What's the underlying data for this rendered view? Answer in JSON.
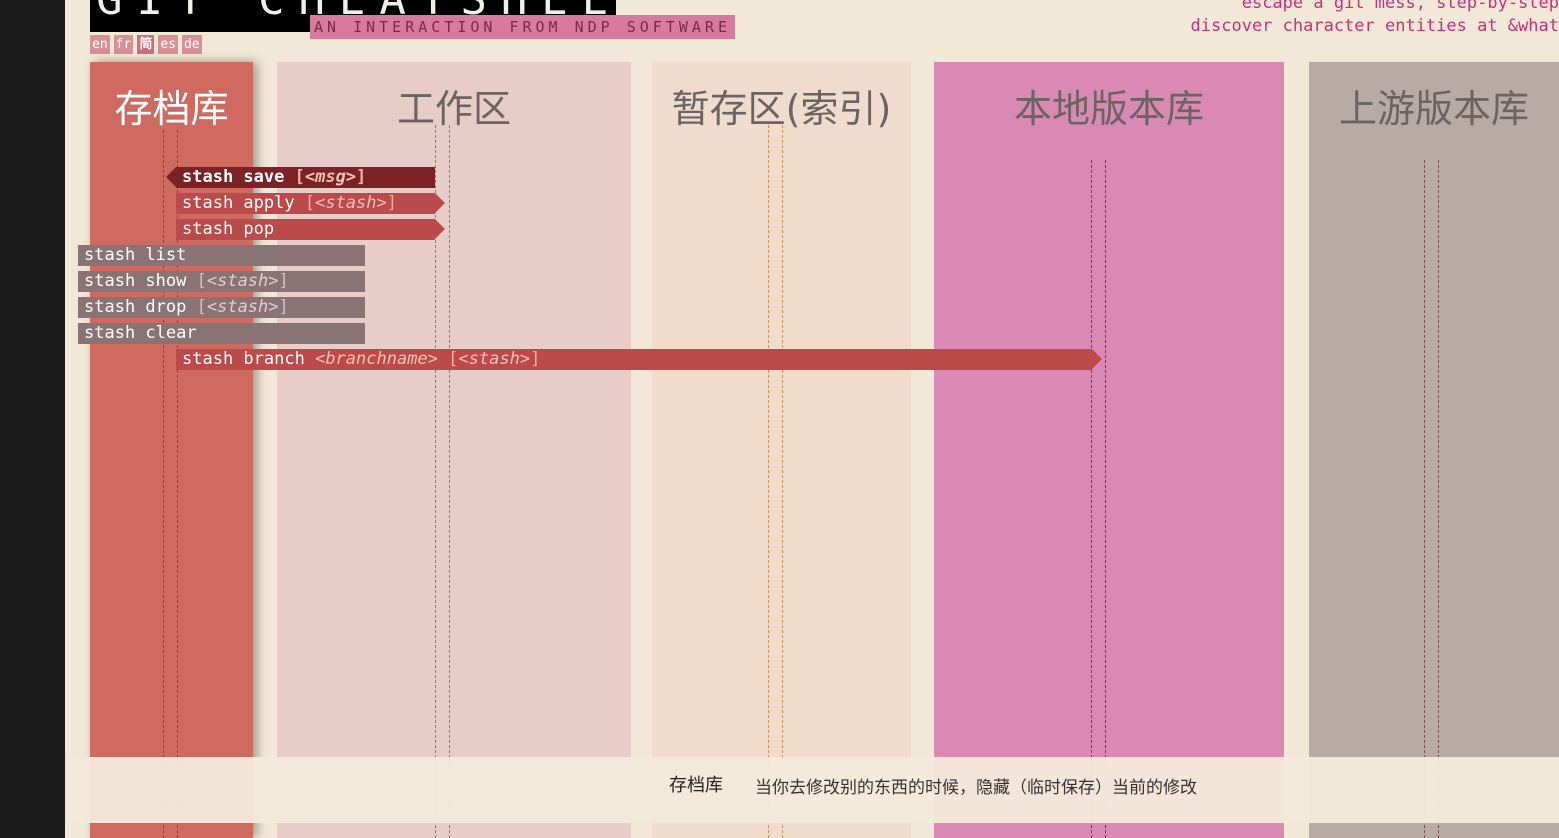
{
  "header": {
    "logo_text": "GIT CHEATSHEET",
    "subtitle": "AN INTERACTION FROM NDP SOFTWARE",
    "tagline_line1": "escape a git mess, step-by-step",
    "tagline_line2": "discover character entities at &what"
  },
  "languages": [
    "en",
    "fr",
    "简",
    "es",
    "de"
  ],
  "active_language": "简",
  "columns": [
    {
      "id": "stash",
      "title": "存档库",
      "color": "#cf6a61"
    },
    {
      "id": "workspace",
      "title": "工作区",
      "color": "#e7ccc7"
    },
    {
      "id": "index",
      "title": "暂存区(索引)",
      "color": "#f0dccc"
    },
    {
      "id": "local",
      "title": "本地版本库",
      "color": "#d989b4"
    },
    {
      "id": "upstream",
      "title": "上游版本库",
      "color": "#b8aaa5"
    }
  ],
  "commands": [
    {
      "name": "stash save",
      "open": "[",
      "arg": "<msg>",
      "close": "]"
    },
    {
      "name": "stash apply",
      "open": "[",
      "arg": "<stash>",
      "close": "]"
    },
    {
      "name": "stash pop",
      "open": "",
      "arg": "",
      "close": ""
    },
    {
      "name": "stash list",
      "open": "",
      "arg": "",
      "close": ""
    },
    {
      "name": "stash show",
      "open": "[",
      "arg": "<stash>",
      "close": "]"
    },
    {
      "name": "stash drop",
      "open": "[",
      "arg": "<stash>",
      "close": "]"
    },
    {
      "name": "stash clear",
      "open": "",
      "arg": "",
      "close": ""
    },
    {
      "name": "stash branch",
      "arg1": "<branchname>",
      "open": "[",
      "arg": "<stash>",
      "close": "]"
    }
  ],
  "info": {
    "title": "存档库",
    "description": "当你去修改别的东西的时候，隐藏（临时保存）当前的修改"
  },
  "colors": {
    "background": "#f2e8d8",
    "accent": "#c8307a",
    "command_red": "#bb4a4a",
    "command_grey": "#8a7375",
    "command_selected": "#7b2226"
  }
}
